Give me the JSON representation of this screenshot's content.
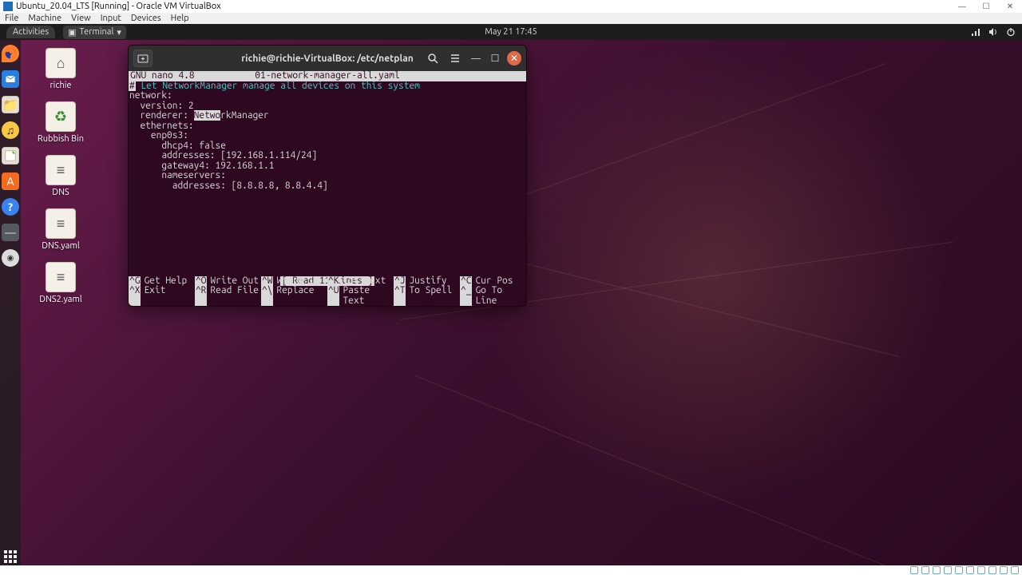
{
  "vbox": {
    "title": "Ubuntu_20.04_LTS [Running] - Oracle VM VirtualBox",
    "menu": [
      "File",
      "Machine",
      "View",
      "Input",
      "Devices",
      "Help"
    ]
  },
  "gnome": {
    "activities": "Activities",
    "app_label": "Terminal",
    "clock": "May 21  17:45"
  },
  "desktop_icons": [
    {
      "name": "home-folder",
      "label": "richie",
      "glyph": "⌂"
    },
    {
      "name": "trash",
      "label": "Rubbish Bin",
      "glyph": "♻"
    },
    {
      "name": "file-dns",
      "label": "DNS",
      "glyph": "≡"
    },
    {
      "name": "file-dns-yaml",
      "label": "DNS.yaml",
      "glyph": "≡"
    },
    {
      "name": "file-dns2-yaml",
      "label": "DNS2.yaml",
      "glyph": "≡"
    }
  ],
  "terminal": {
    "title": "richie@richie-VirtualBox: /etc/netplan",
    "nano": {
      "app": "  GNU nano 4.8",
      "filename": "01-network-manager-all.yaml",
      "comment_hash": "#",
      "comment": " Let NetworkManager manage all devices on this system",
      "lines": {
        "l1": "network:",
        "l2": "  version: 2",
        "l3a": "  renderer: ",
        "l3sel": "Netwo",
        "l3b": "rkManager",
        "l4": "  ethernets:",
        "l5": "    enp0s3:",
        "l6": "      dhcp4: false",
        "l7": "      addresses: [192.168.1.114/24]",
        "l8": "      gateway4: 192.168.1.1",
        "l9": "      nameservers:",
        "l10": "        addresses: [8.8.8.8, 8.8.4.4]"
      },
      "status": "[ Read 11 lines ]",
      "shortcuts": {
        "row1": [
          {
            "key": "^G",
            "label": "Get Help"
          },
          {
            "key": "^O",
            "label": "Write Out"
          },
          {
            "key": "^W",
            "label": "Where Is"
          },
          {
            "key": "^K",
            "label": "Cut Text"
          },
          {
            "key": "^J",
            "label": "Justify"
          },
          {
            "key": "^C",
            "label": "Cur Pos"
          }
        ],
        "row2": [
          {
            "key": "^X",
            "label": "Exit"
          },
          {
            "key": "^R",
            "label": "Read File"
          },
          {
            "key": "^\\",
            "label": "Replace"
          },
          {
            "key": "^U",
            "label": "Paste Text"
          },
          {
            "key": "^T",
            "label": "To Spell"
          },
          {
            "key": "^_",
            "label": "Go To Line"
          }
        ]
      }
    }
  }
}
